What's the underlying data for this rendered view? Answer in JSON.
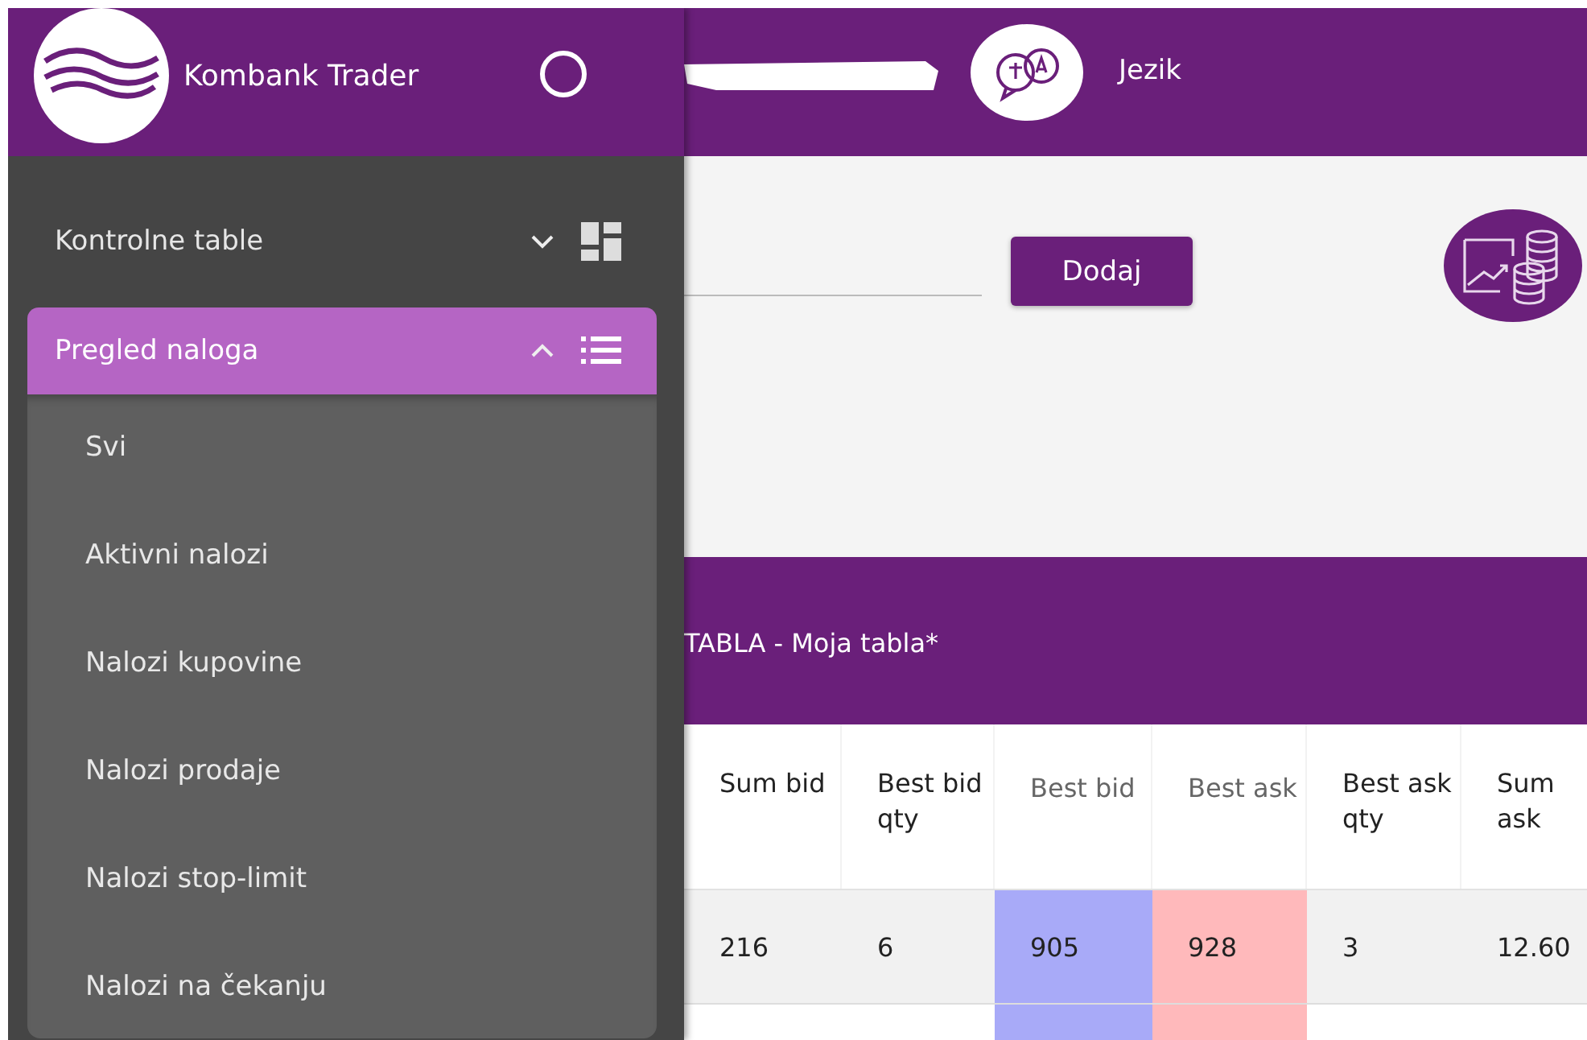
{
  "app": {
    "title": "Kombank Trader"
  },
  "topbar": {
    "language_label": "Jezik"
  },
  "drawer": {
    "items": [
      {
        "label": "Kontrolne table",
        "kind": "dashboard",
        "expanded": false,
        "selected": false
      },
      {
        "label": "Pregled naloga",
        "kind": "list",
        "expanded": true,
        "selected": true,
        "children": [
          {
            "label": "Svi"
          },
          {
            "label": "Aktivni nalozi"
          },
          {
            "label": "Nalozi kupovine"
          },
          {
            "label": "Nalozi prodaje"
          },
          {
            "label": "Nalozi stop-limit"
          },
          {
            "label": "Nalozi na čekanju"
          }
        ]
      }
    ]
  },
  "toolbar": {
    "add_button": "Dodaj"
  },
  "panel": {
    "title": "TABLA - Moja tabla*"
  },
  "table": {
    "columns": [
      {
        "label": "Sum bid",
        "kind": "plain"
      },
      {
        "label": "Best bid qty",
        "kind": "plain"
      },
      {
        "label": "Best bid",
        "kind": "bid"
      },
      {
        "label": "Best ask",
        "kind": "ask"
      },
      {
        "label": "Best ask qty",
        "kind": "plain"
      },
      {
        "label": "Sum ask",
        "kind": "plain"
      }
    ],
    "rows": [
      [
        "216",
        "6",
        "905",
        "928",
        "3",
        "12.60"
      ]
    ]
  }
}
